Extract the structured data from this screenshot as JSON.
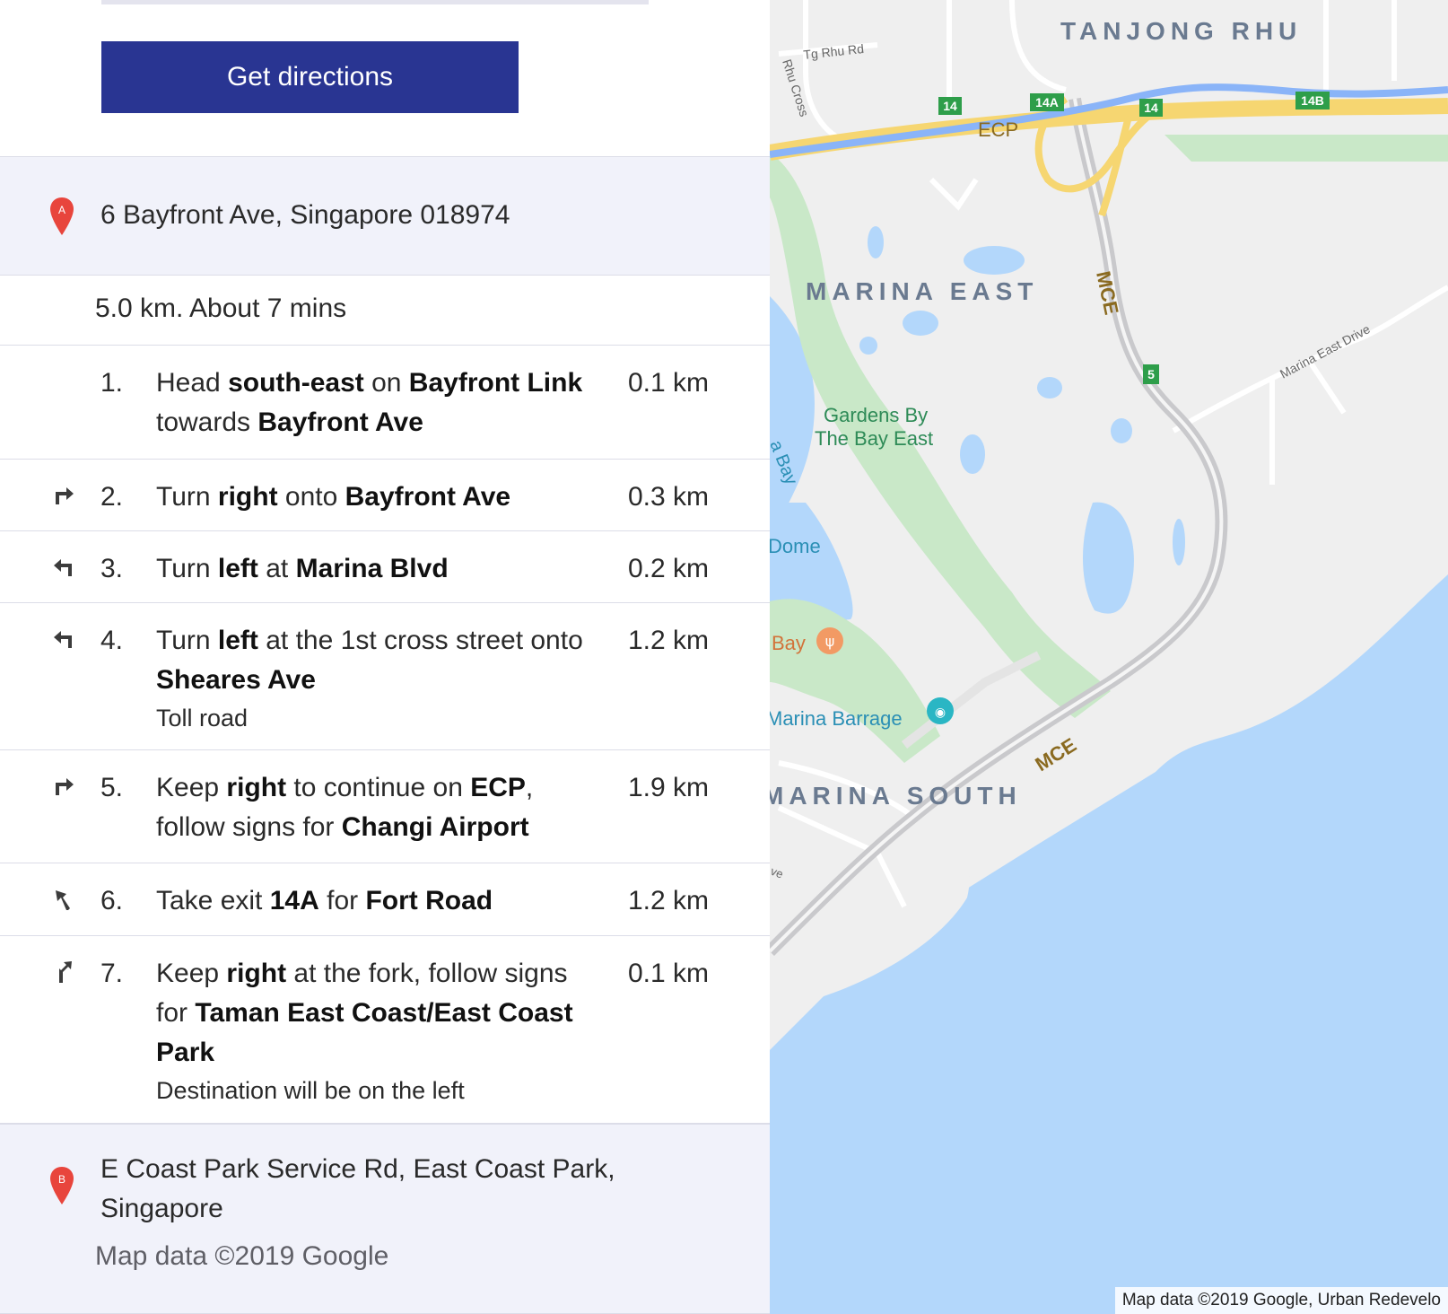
{
  "actions": {
    "get_directions_label": "Get directions"
  },
  "origin": {
    "marker": "A",
    "address": "6 Bayfront Ave, Singapore 018974"
  },
  "summary": "5.0 km. About 7 mins",
  "steps": [
    {
      "icon": "straight",
      "number": "1.",
      "parts": [
        [
          "Head ",
          0
        ],
        [
          "south-east",
          1
        ],
        [
          " on ",
          0
        ],
        [
          "Bayfront Link",
          1
        ],
        [
          " towards ",
          0
        ],
        [
          "Bayfront Ave",
          1
        ]
      ],
      "note": "",
      "distance": "0.1 km"
    },
    {
      "icon": "turn-right-icon",
      "number": "2.",
      "parts": [
        [
          "Turn ",
          0
        ],
        [
          "right",
          1
        ],
        [
          " onto ",
          0
        ],
        [
          "Bayfront Ave",
          1
        ]
      ],
      "note": "",
      "distance": "0.3 km"
    },
    {
      "icon": "turn-left-icon",
      "number": "3.",
      "parts": [
        [
          "Turn ",
          0
        ],
        [
          "left",
          1
        ],
        [
          " at ",
          0
        ],
        [
          "Marina Blvd",
          1
        ]
      ],
      "note": "",
      "distance": "0.2 km"
    },
    {
      "icon": "turn-left-icon",
      "number": "4.",
      "parts": [
        [
          "Turn ",
          0
        ],
        [
          "left",
          1
        ],
        [
          " at the 1st cross street onto ",
          0
        ],
        [
          "Sheares Ave",
          1
        ]
      ],
      "note": "Toll road",
      "distance": "1.2 km"
    },
    {
      "icon": "turn-right-icon",
      "number": "5.",
      "parts": [
        [
          "Keep ",
          0
        ],
        [
          "right",
          1
        ],
        [
          " to continue on ",
          0
        ],
        [
          "ECP",
          1
        ],
        [
          ", follow signs for ",
          0
        ],
        [
          "Changi Airport",
          1
        ]
      ],
      "note": "",
      "distance": "1.9 km"
    },
    {
      "icon": "ramp-left-icon",
      "number": "6.",
      "parts": [
        [
          "Take exit ",
          0
        ],
        [
          "14A",
          1
        ],
        [
          " for ",
          0
        ],
        [
          "Fort Road",
          1
        ]
      ],
      "note": "",
      "distance": "1.2 km"
    },
    {
      "icon": "fork-right-icon",
      "number": "7.",
      "parts": [
        [
          "Keep ",
          0
        ],
        [
          "right",
          1
        ],
        [
          " at the fork, follow signs for ",
          0
        ],
        [
          "Taman East Coast/East Coast Park",
          1
        ]
      ],
      "note": "Destination will be on the left",
      "distance": "0.1 km"
    }
  ],
  "destination": {
    "marker": "B",
    "address": "E Coast Park Service Rd, East Coast Park, Singapore"
  },
  "panel_copyright": "Map data ©2019 Google",
  "map": {
    "attribution": "Map data ©2019 Google, Urban Redevelo",
    "area_labels": [
      "TANJONG RHU",
      "MARINA EAST",
      "MARINA SOUTH"
    ],
    "road_labels": [
      "Tg Rhu Rd",
      "Rhu Cross",
      "ECP",
      "MCE",
      "MCE",
      "Marina East Drive"
    ],
    "exit_badges": [
      "14",
      "14A",
      "14",
      "14B",
      "5"
    ],
    "poi_labels": [
      "Gardens By The Bay East",
      "Marina Barrage",
      "Bay",
      "Dome",
      "a Bay",
      "ve"
    ],
    "colors": {
      "water": "#b3d7fb",
      "land": "#efefef",
      "park": "#c9e8c8",
      "highway": "#f6d671",
      "expressway": "#8ab4f8",
      "badge": "#2e9e4a",
      "poi": "#f29a64"
    }
  }
}
